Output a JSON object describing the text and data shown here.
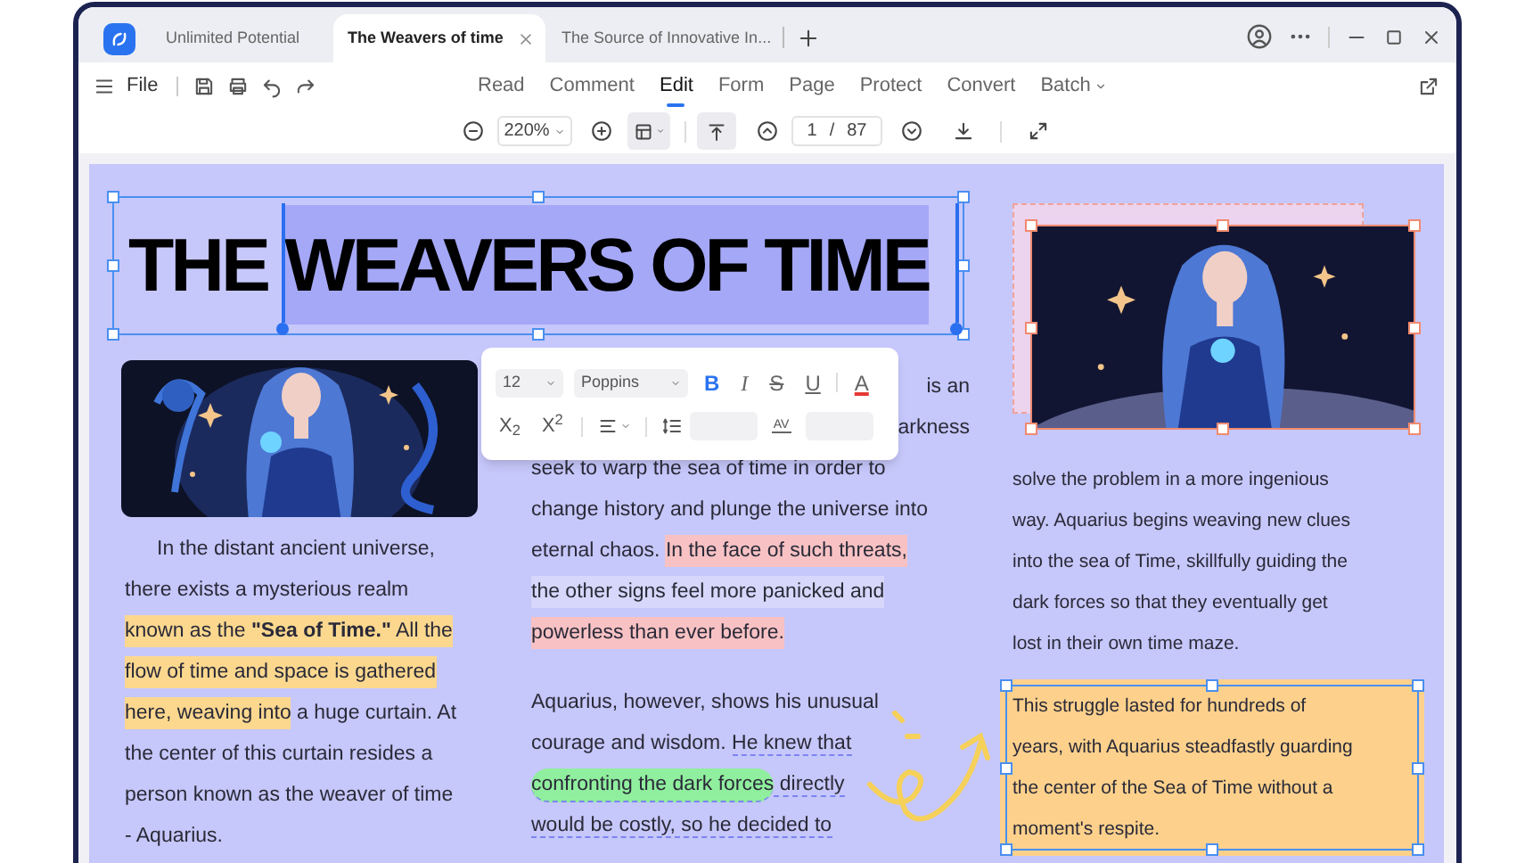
{
  "app_tabs": [
    {
      "title": "Unlimited Potential",
      "selected": false
    },
    {
      "title": "The Weavers of time",
      "selected": true
    },
    {
      "title": "The Source of Innovative In...",
      "selected": false
    }
  ],
  "menu": {
    "file": "File"
  },
  "ribbon_tabs": [
    {
      "label": "Read",
      "selected": false,
      "dropdown": false
    },
    {
      "label": "Comment",
      "selected": false,
      "dropdown": false
    },
    {
      "label": "Edit",
      "selected": true,
      "dropdown": false
    },
    {
      "label": "Form",
      "selected": false,
      "dropdown": false
    },
    {
      "label": "Page",
      "selected": false,
      "dropdown": false
    },
    {
      "label": "Protect",
      "selected": false,
      "dropdown": false
    },
    {
      "label": "Convert",
      "selected": false,
      "dropdown": false
    },
    {
      "label": "Batch",
      "selected": false,
      "dropdown": true
    }
  ],
  "toolbar": {
    "zoom": "220%",
    "page": "1",
    "page_separator": "/",
    "page_count": "87"
  },
  "document": {
    "title_parts": [
      {
        "text": "THE ",
        "selected": false
      },
      {
        "text": "WEAVERS OF TIME",
        "selected": true
      }
    ],
    "left_column": {
      "first_line_indent": true,
      "lines": [
        [
          {
            "text": "In the distant ancient universe,",
            "kind": "plain"
          }
        ],
        [
          {
            "text": "there exists a mysterious realm",
            "kind": "plain"
          }
        ],
        [
          {
            "text": "known as the **\"Sea of Time.\"** All the",
            "kind": "highlight"
          }
        ],
        [
          {
            "text": "flow of time and space is gathered",
            "kind": "highlight"
          }
        ],
        [
          {
            "text": "here, weaving into",
            "kind": "highlight"
          },
          {
            "text": " a huge curtain. At",
            "kind": "plain"
          }
        ],
        [
          {
            "text": "the center of this curtain resides a",
            "kind": "plain"
          }
        ],
        [
          {
            "text": "person known as the weaver of time",
            "kind": "plain"
          }
        ],
        [
          {
            "text": "- Aquarius.",
            "kind": "plain"
          }
        ]
      ]
    },
    "middle_column": [
      {
        "kind": "tail",
        "lines": [
          [
            {
              "text": "is an",
              "kind": "plain"
            }
          ],
          [
            {
              "text": "arkness",
              "kind": "plain"
            }
          ]
        ]
      },
      {
        "kind": "body",
        "lines": [
          [
            {
              "text": "seek to warp the sea of time in order to",
              "kind": "plain"
            }
          ],
          [
            {
              "text": "change history and plunge the universe into",
              "kind": "plain"
            }
          ],
          [
            {
              "text": "eternal chaos. ",
              "kind": "plain"
            },
            {
              "text": "In the face of such threats,",
              "kind": "alert"
            }
          ],
          [
            {
              "text": "the other signs feel more panicked and",
              "kind": "soft"
            }
          ],
          [
            {
              "text": "powerless than ever before.",
              "kind": "alert"
            }
          ]
        ]
      },
      {
        "kind": "paragraph",
        "lines": [
          [
            {
              "text": "Aquarius, however, shows his unusual",
              "kind": "plain"
            }
          ],
          [
            {
              "text": "courage and wisdom. ",
              "kind": "plain"
            },
            {
              "text": "He knew that",
              "kind": "underlined"
            }
          ],
          [
            {
              "text": "confronting the dark forces",
              "kind": "marker"
            },
            {
              "text": " directly",
              "kind": "underlined"
            }
          ],
          [
            {
              "text": "would be costly, so he decided to",
              "kind": "underlined"
            }
          ]
        ]
      }
    ],
    "right_column": {
      "lines": [
        [
          {
            "text": "solve the problem in a more ingenious",
            "kind": "plain"
          }
        ],
        [
          {
            "text": "way. Aquarius begins weaving new clues",
            "kind": "plain"
          }
        ],
        [
          {
            "text": "into the sea of Time, skillfully guiding the",
            "kind": "plain"
          }
        ],
        [
          {
            "text": "dark forces so that they eventually get",
            "kind": "plain"
          }
        ],
        [
          {
            "text": "lost in their own time maze.",
            "kind": "plain"
          }
        ]
      ]
    },
    "text_box": {
      "lines": [
        [
          {
            "text": "This struggle lasted for hundreds of",
            "kind": "plain"
          }
        ],
        [
          {
            "text": "years, with Aquarius steadfastly guarding",
            "kind": "plain"
          }
        ],
        [
          {
            "text": "the center of the Sea of Time without a",
            "kind": "plain"
          }
        ],
        [
          {
            "text": "moment's respite.",
            "kind": "plain"
          }
        ]
      ]
    },
    "format_toolbar": {
      "font_size": "12",
      "font": "Poppins",
      "style_buttons": [
        {
          "label": "B",
          "kind": "bold",
          "active": true
        },
        {
          "label": "I",
          "kind": "italic",
          "active": false
        },
        {
          "label": "S",
          "kind": "strike",
          "active": false
        },
        {
          "label": "U",
          "kind": "underline",
          "active": false
        },
        {
          "label": "A",
          "kind": "color",
          "active": false
        }
      ],
      "script_buttons": [
        {
          "label": "X$_{2}$"
        },
        {
          "label": "X$^{2}$"
        }
      ],
      "spacing_label": "AV"
    }
  }
}
